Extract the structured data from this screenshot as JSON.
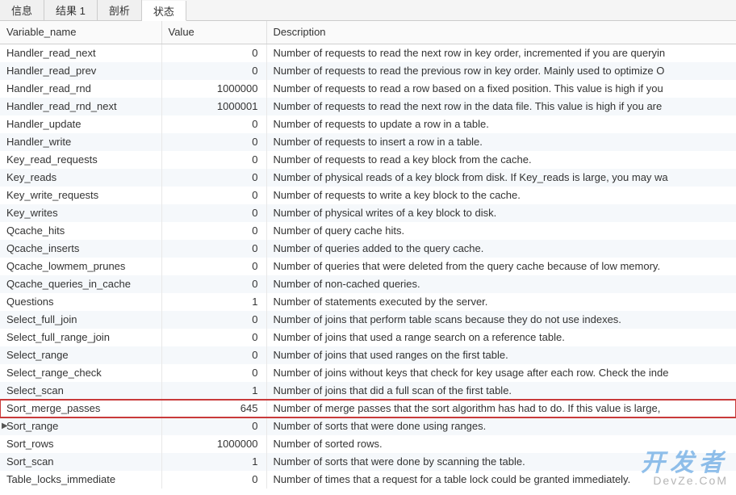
{
  "tabs": [
    {
      "label": "信息",
      "active": false
    },
    {
      "label": "结果 1",
      "active": false
    },
    {
      "label": "剖析",
      "active": false
    },
    {
      "label": "状态",
      "active": true
    }
  ],
  "columns": {
    "variable": "Variable_name",
    "value": "Value",
    "description": "Description"
  },
  "rows": [
    {
      "name": "Handler_read_next",
      "value": "0",
      "desc": "Number of requests to read the next row in key order, incremented if you are queryin"
    },
    {
      "name": "Handler_read_prev",
      "value": "0",
      "desc": "Number of requests to read the previous row in key order. Mainly used to optimize O"
    },
    {
      "name": "Handler_read_rnd",
      "value": "1000000",
      "desc": "Number of requests to read a row based on a fixed position. This value is high if you"
    },
    {
      "name": "Handler_read_rnd_next",
      "value": "1000001",
      "desc": "Number of requests to read the next row in the data file. This value is high if you are"
    },
    {
      "name": "Handler_update",
      "value": "0",
      "desc": "Number of requests to update a row in a table."
    },
    {
      "name": "Handler_write",
      "value": "0",
      "desc": "Number of requests to insert a row in a table."
    },
    {
      "name": "Key_read_requests",
      "value": "0",
      "desc": "Number of requests to read a key block from the cache."
    },
    {
      "name": "Key_reads",
      "value": "0",
      "desc": "Number of physical reads of a key block from disk. If Key_reads is large, you may wa"
    },
    {
      "name": "Key_write_requests",
      "value": "0",
      "desc": "Number of requests to write a key block to the cache."
    },
    {
      "name": "Key_writes",
      "value": "0",
      "desc": "Number of physical writes of a key block to disk."
    },
    {
      "name": "Qcache_hits",
      "value": "0",
      "desc": "Number of query cache hits."
    },
    {
      "name": "Qcache_inserts",
      "value": "0",
      "desc": "Number of queries added to the query cache."
    },
    {
      "name": "Qcache_lowmem_prunes",
      "value": "0",
      "desc": "Number of queries that were deleted from the query cache because of low memory."
    },
    {
      "name": "Qcache_queries_in_cache",
      "value": "0",
      "desc": "Number of non-cached queries."
    },
    {
      "name": "Questions",
      "value": "1",
      "desc": "Number of statements executed by the server."
    },
    {
      "name": "Select_full_join",
      "value": "0",
      "desc": "Number of joins that perform table scans because they do not use indexes."
    },
    {
      "name": "Select_full_range_join",
      "value": "0",
      "desc": "Number of joins that used a range search on a reference table."
    },
    {
      "name": "Select_range",
      "value": "0",
      "desc": "Number of joins that used ranges on the first table."
    },
    {
      "name": "Select_range_check",
      "value": "0",
      "desc": "Number of joins without keys that check for key usage after each row. Check the inde"
    },
    {
      "name": "Select_scan",
      "value": "1",
      "desc": "Number of joins that did a full scan of the first table."
    },
    {
      "name": "Sort_merge_passes",
      "value": "645",
      "desc": "Number of merge passes that the sort algorithm has had to do. If this value is large,",
      "highlighted": true
    },
    {
      "name": "Sort_range",
      "value": "0",
      "desc": "Number of sorts that were done using ranges.",
      "indicator": true
    },
    {
      "name": "Sort_rows",
      "value": "1000000",
      "desc": "Number of sorted rows."
    },
    {
      "name": "Sort_scan",
      "value": "1",
      "desc": "Number of sorts that were done by scanning the table."
    },
    {
      "name": "Table_locks_immediate",
      "value": "0",
      "desc": "Number of times that a request for a table lock could be granted immediately."
    }
  ],
  "watermark": {
    "main": "开发者",
    "sub": "DevZe.CoM"
  }
}
